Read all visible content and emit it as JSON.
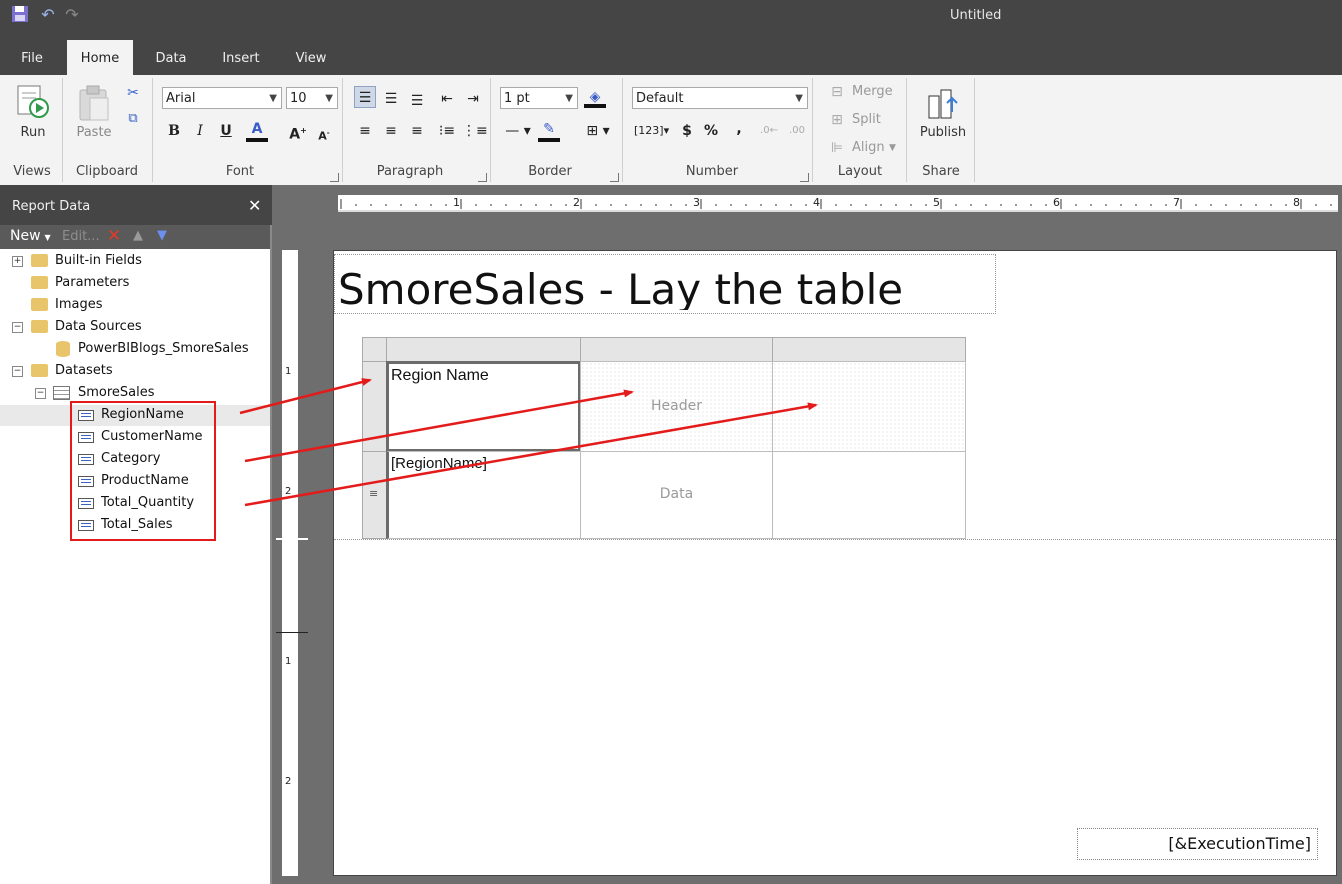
{
  "window": {
    "title": "Untitled"
  },
  "quick_access": {
    "save_icon": "save-icon",
    "undo_icon": "undo-icon",
    "redo_icon": "redo-icon"
  },
  "tabs": [
    "File",
    "Home",
    "Data",
    "Insert",
    "View"
  ],
  "active_tab": "Home",
  "ribbon": {
    "views": {
      "run_label": "Run",
      "group": "Views"
    },
    "clipboard": {
      "paste_label": "Paste",
      "group": "Clipboard"
    },
    "font": {
      "family": "Arial",
      "size": "10",
      "group": "Font"
    },
    "paragraph": {
      "group": "Paragraph"
    },
    "border": {
      "width": "1 pt",
      "group": "Border"
    },
    "number": {
      "format": "Default",
      "group": "Number"
    },
    "layout": {
      "merge": "Merge",
      "split": "Split",
      "align": "Align",
      "group": "Layout"
    },
    "share": {
      "publish": "Publish",
      "group": "Share"
    }
  },
  "report_data": {
    "title": "Report Data",
    "toolbar": {
      "new": "New",
      "edit": "Edit..."
    },
    "tree": {
      "builtin": "Built-in Fields",
      "parameters": "Parameters",
      "images": "Images",
      "data_sources": "Data Sources",
      "data_source_item": "PowerBIBlogs_SmoreSales",
      "datasets": "Datasets",
      "dataset": "SmoreSales",
      "fields": [
        "RegionName",
        "CustomerName",
        "Category",
        "ProductName",
        "Total_Quantity",
        "Total_Sales"
      ]
    }
  },
  "ruler": {
    "h_ticks": [
      "1",
      "2",
      "3",
      "4",
      "5",
      "6",
      "7",
      "8"
    ],
    "v_ticks": [
      "1",
      "2",
      "1",
      "2"
    ]
  },
  "report": {
    "title": "SmoreSales - Lay the table",
    "table": {
      "header": [
        "Region Name",
        "Header",
        ""
      ],
      "data": [
        "[RegionName]",
        "Data",
        ""
      ]
    },
    "execution_time": "[&ExecutionTime]"
  },
  "colors": {
    "accent": "#e31b1b",
    "chrome": "#454545",
    "ribbon": "#f3f3f3",
    "surface": "#6e6e6e"
  }
}
